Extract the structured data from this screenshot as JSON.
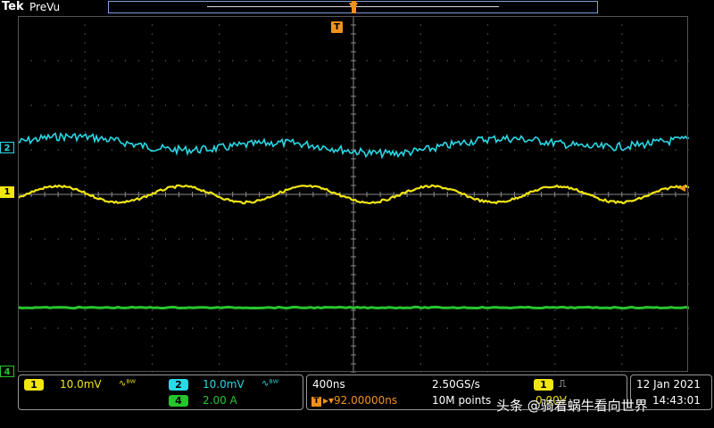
{
  "header": {
    "brand": "Tek",
    "mode": "PreVu"
  },
  "trigger": {
    "marker_label": "T"
  },
  "channels": [
    {
      "id": "2",
      "marker": "2",
      "color": "#2ad8e6"
    },
    {
      "id": "1",
      "marker": "1",
      "color": "#f1e613"
    },
    {
      "id": "4",
      "marker": "4",
      "color": "#27c52d"
    }
  ],
  "readout": {
    "ch1": {
      "badge": "1",
      "scale": "10.0mV",
      "bw_icon": "∿ᴮᵂ",
      "color": "#f1e613"
    },
    "ch2": {
      "badge": "2",
      "scale": "10.0mV",
      "bw_icon": "∿ᴮᵂ",
      "color": "#2ad8e6"
    },
    "ch4": {
      "badge": "4",
      "scale": "2.00 A",
      "color": "#27c52d"
    },
    "timebase": "400ns",
    "sample_rate": "2.50GS/s",
    "trigger_offset": "▸▾92.00000ns",
    "record_length": "10M points",
    "trigger_source_badge": "1",
    "trigger_slope": "⎍",
    "trigger_level": "0.00V",
    "date": "12 Jan 2021",
    "time": "14:43:01"
  },
  "watermark": "头条 @骑着蜗牛看向世界",
  "colors": {
    "accent": "#f0921c",
    "grid": "#6a6a6a"
  }
}
